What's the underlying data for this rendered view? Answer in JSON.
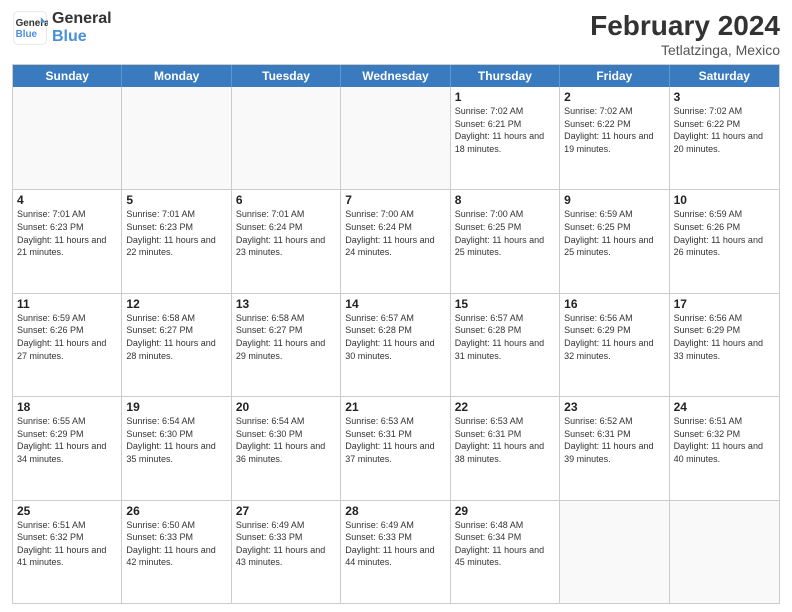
{
  "logo": {
    "line1": "General",
    "line2": "Blue"
  },
  "title": {
    "month": "February 2024",
    "location": "Tetlatzinga, Mexico"
  },
  "weekdays": [
    "Sunday",
    "Monday",
    "Tuesday",
    "Wednesday",
    "Thursday",
    "Friday",
    "Saturday"
  ],
  "rows": [
    [
      {
        "day": "",
        "empty": true
      },
      {
        "day": "",
        "empty": true
      },
      {
        "day": "",
        "empty": true
      },
      {
        "day": "",
        "empty": true
      },
      {
        "day": "1",
        "sunrise": "7:02 AM",
        "sunset": "6:21 PM",
        "daylight": "11 hours and 18 minutes."
      },
      {
        "day": "2",
        "sunrise": "7:02 AM",
        "sunset": "6:22 PM",
        "daylight": "11 hours and 19 minutes."
      },
      {
        "day": "3",
        "sunrise": "7:02 AM",
        "sunset": "6:22 PM",
        "daylight": "11 hours and 20 minutes."
      }
    ],
    [
      {
        "day": "4",
        "sunrise": "7:01 AM",
        "sunset": "6:23 PM",
        "daylight": "11 hours and 21 minutes."
      },
      {
        "day": "5",
        "sunrise": "7:01 AM",
        "sunset": "6:23 PM",
        "daylight": "11 hours and 22 minutes."
      },
      {
        "day": "6",
        "sunrise": "7:01 AM",
        "sunset": "6:24 PM",
        "daylight": "11 hours and 23 minutes."
      },
      {
        "day": "7",
        "sunrise": "7:00 AM",
        "sunset": "6:24 PM",
        "daylight": "11 hours and 24 minutes."
      },
      {
        "day": "8",
        "sunrise": "7:00 AM",
        "sunset": "6:25 PM",
        "daylight": "11 hours and 25 minutes."
      },
      {
        "day": "9",
        "sunrise": "6:59 AM",
        "sunset": "6:25 PM",
        "daylight": "11 hours and 25 minutes."
      },
      {
        "day": "10",
        "sunrise": "6:59 AM",
        "sunset": "6:26 PM",
        "daylight": "11 hours and 26 minutes."
      }
    ],
    [
      {
        "day": "11",
        "sunrise": "6:59 AM",
        "sunset": "6:26 PM",
        "daylight": "11 hours and 27 minutes."
      },
      {
        "day": "12",
        "sunrise": "6:58 AM",
        "sunset": "6:27 PM",
        "daylight": "11 hours and 28 minutes."
      },
      {
        "day": "13",
        "sunrise": "6:58 AM",
        "sunset": "6:27 PM",
        "daylight": "11 hours and 29 minutes."
      },
      {
        "day": "14",
        "sunrise": "6:57 AM",
        "sunset": "6:28 PM",
        "daylight": "11 hours and 30 minutes."
      },
      {
        "day": "15",
        "sunrise": "6:57 AM",
        "sunset": "6:28 PM",
        "daylight": "11 hours and 31 minutes."
      },
      {
        "day": "16",
        "sunrise": "6:56 AM",
        "sunset": "6:29 PM",
        "daylight": "11 hours and 32 minutes."
      },
      {
        "day": "17",
        "sunrise": "6:56 AM",
        "sunset": "6:29 PM",
        "daylight": "11 hours and 33 minutes."
      }
    ],
    [
      {
        "day": "18",
        "sunrise": "6:55 AM",
        "sunset": "6:29 PM",
        "daylight": "11 hours and 34 minutes."
      },
      {
        "day": "19",
        "sunrise": "6:54 AM",
        "sunset": "6:30 PM",
        "daylight": "11 hours and 35 minutes."
      },
      {
        "day": "20",
        "sunrise": "6:54 AM",
        "sunset": "6:30 PM",
        "daylight": "11 hours and 36 minutes."
      },
      {
        "day": "21",
        "sunrise": "6:53 AM",
        "sunset": "6:31 PM",
        "daylight": "11 hours and 37 minutes."
      },
      {
        "day": "22",
        "sunrise": "6:53 AM",
        "sunset": "6:31 PM",
        "daylight": "11 hours and 38 minutes."
      },
      {
        "day": "23",
        "sunrise": "6:52 AM",
        "sunset": "6:31 PM",
        "daylight": "11 hours and 39 minutes."
      },
      {
        "day": "24",
        "sunrise": "6:51 AM",
        "sunset": "6:32 PM",
        "daylight": "11 hours and 40 minutes."
      }
    ],
    [
      {
        "day": "25",
        "sunrise": "6:51 AM",
        "sunset": "6:32 PM",
        "daylight": "11 hours and 41 minutes."
      },
      {
        "day": "26",
        "sunrise": "6:50 AM",
        "sunset": "6:33 PM",
        "daylight": "11 hours and 42 minutes."
      },
      {
        "day": "27",
        "sunrise": "6:49 AM",
        "sunset": "6:33 PM",
        "daylight": "11 hours and 43 minutes."
      },
      {
        "day": "28",
        "sunrise": "6:49 AM",
        "sunset": "6:33 PM",
        "daylight": "11 hours and 44 minutes."
      },
      {
        "day": "29",
        "sunrise": "6:48 AM",
        "sunset": "6:34 PM",
        "daylight": "11 hours and 45 minutes."
      },
      {
        "day": "",
        "empty": true
      },
      {
        "day": "",
        "empty": true
      }
    ]
  ]
}
